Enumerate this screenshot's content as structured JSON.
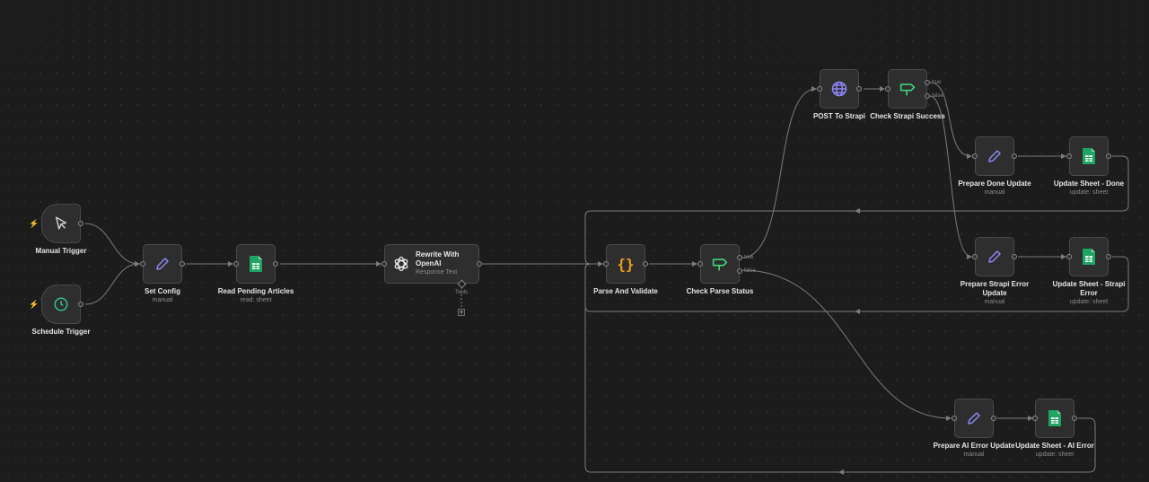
{
  "nodes": {
    "manual_trigger": {
      "title": "Manual Trigger",
      "subtitle": "",
      "icon": "cursor-icon"
    },
    "schedule_trigger": {
      "title": "Schedule Trigger",
      "subtitle": "",
      "icon": "clock-icon"
    },
    "set_config": {
      "title": "Set Config",
      "subtitle": "manual",
      "icon": "pencil-icon"
    },
    "read_pending": {
      "title": "Read Pending Articles",
      "subtitle": "read: sheet",
      "icon": "sheet-icon"
    },
    "rewrite_openai": {
      "title": "Rewrite With\nOpenAI",
      "subtitle": "Response Text",
      "icon": "openai-icon",
      "tools_label": "Tools",
      "add_tool": "+"
    },
    "parse_validate": {
      "title": "Parse And Validate",
      "subtitle": "",
      "icon": "code-braces-icon"
    },
    "check_parse": {
      "title": "Check Parse Status",
      "subtitle": "",
      "icon": "signpost-icon",
      "true_label": "true",
      "false_label": "false"
    },
    "post_strapi": {
      "title": "POST To Strapi",
      "subtitle": "",
      "icon": "globe-icon"
    },
    "check_strapi": {
      "title": "Check Strapi Success",
      "subtitle": "",
      "icon": "signpost-icon",
      "true_label": "true",
      "false_label": "false"
    },
    "prepare_done": {
      "title": "Prepare Done Update",
      "subtitle": "manual",
      "icon": "pencil-icon"
    },
    "update_done": {
      "title": "Update Sheet - Done",
      "subtitle": "update: sheet",
      "icon": "sheet-icon"
    },
    "prepare_strapi_error": {
      "title": "Prepare Strapi Error Update",
      "subtitle": "manual",
      "icon": "pencil-icon"
    },
    "update_strapi_error": {
      "title": "Update Sheet - Strapi Error",
      "subtitle": "update: sheet",
      "icon": "sheet-icon"
    },
    "prepare_ai_error": {
      "title": "Prepare AI Error Update",
      "subtitle": "manual",
      "icon": "pencil-icon"
    },
    "update_ai_error": {
      "title": "Update Sheet - AI Error",
      "subtitle": "update: sheet",
      "icon": "sheet-icon"
    }
  },
  "colors": {
    "edge": "#7c7c7c",
    "pencil": "#8c87f5",
    "sheet": "#20a464",
    "clock": "#35c09a",
    "braces": "#f0a020",
    "signpost": "#3fd27a",
    "globe": "#8c87f5",
    "bolt": "#e05a3c"
  }
}
